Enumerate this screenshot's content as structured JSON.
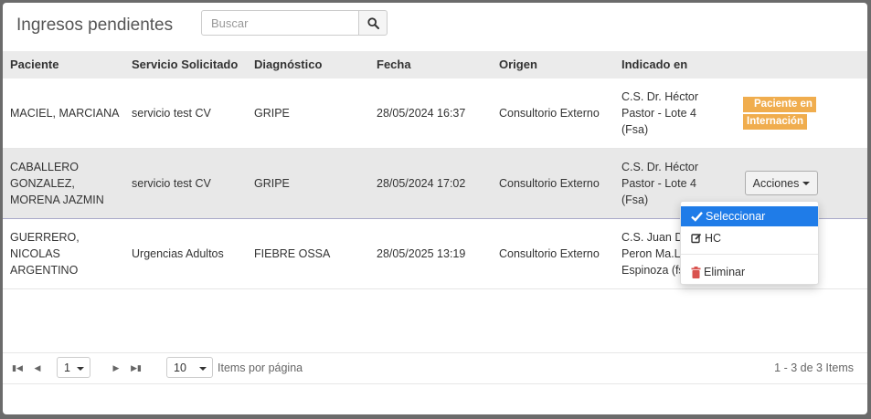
{
  "modal": {
    "title": "Ingresos pendientes",
    "search": {
      "placeholder": "Buscar",
      "value": ""
    }
  },
  "table": {
    "columns": [
      "Paciente",
      "Servicio Solicitado",
      "Diagnóstico",
      "Fecha",
      "Origen",
      "Indicado en"
    ],
    "rows": [
      {
        "paciente": [
          "MACIEL, MARCIANA"
        ],
        "servicio": "servicio test CV",
        "diagnostico": "GRIPE",
        "fecha": "28/05/2024 16:37",
        "origen": "Consultorio Externo",
        "indicado": [
          "C.S. Dr. Héctor",
          "Pastor - Lote 4",
          "(Fsa)"
        ],
        "badge": [
          "Paciente en",
          "Internación"
        ]
      },
      {
        "paciente": [
          "CABALLERO",
          "GONZALEZ,",
          "MORENA JAZMIN"
        ],
        "servicio": "servicio test CV",
        "diagnostico": "GRIPE",
        "fecha": "28/05/2024 17:02",
        "origen": "Consultorio Externo",
        "indicado": [
          "C.S. Dr. Héctor",
          "Pastor - Lote 4",
          "(Fsa)"
        ],
        "action_label": "Acciones"
      },
      {
        "paciente": [
          "GUERRERO,",
          "NICOLAS",
          "ARGENTINO"
        ],
        "servicio": "Urgencias Adultos",
        "diagnostico": "FIEBRE OSSA",
        "fecha": "28/05/2025 13:19",
        "origen": "Consultorio Externo",
        "indicado": [
          "C.S. Juan D",
          "Peron Ma.Lu",
          "Espinoza (fs"
        ]
      }
    ]
  },
  "dropdown": {
    "items": [
      "Seleccionar",
      "HC",
      "Eliminar"
    ]
  },
  "pager": {
    "page": "1",
    "page_size": "10",
    "items_label": "Items por página",
    "summary": "1 - 3 de 3 Items"
  },
  "colors": {
    "accent": "#1f7ce8",
    "badge": "#f0ad4e",
    "delete_icon": "#d9534f"
  }
}
